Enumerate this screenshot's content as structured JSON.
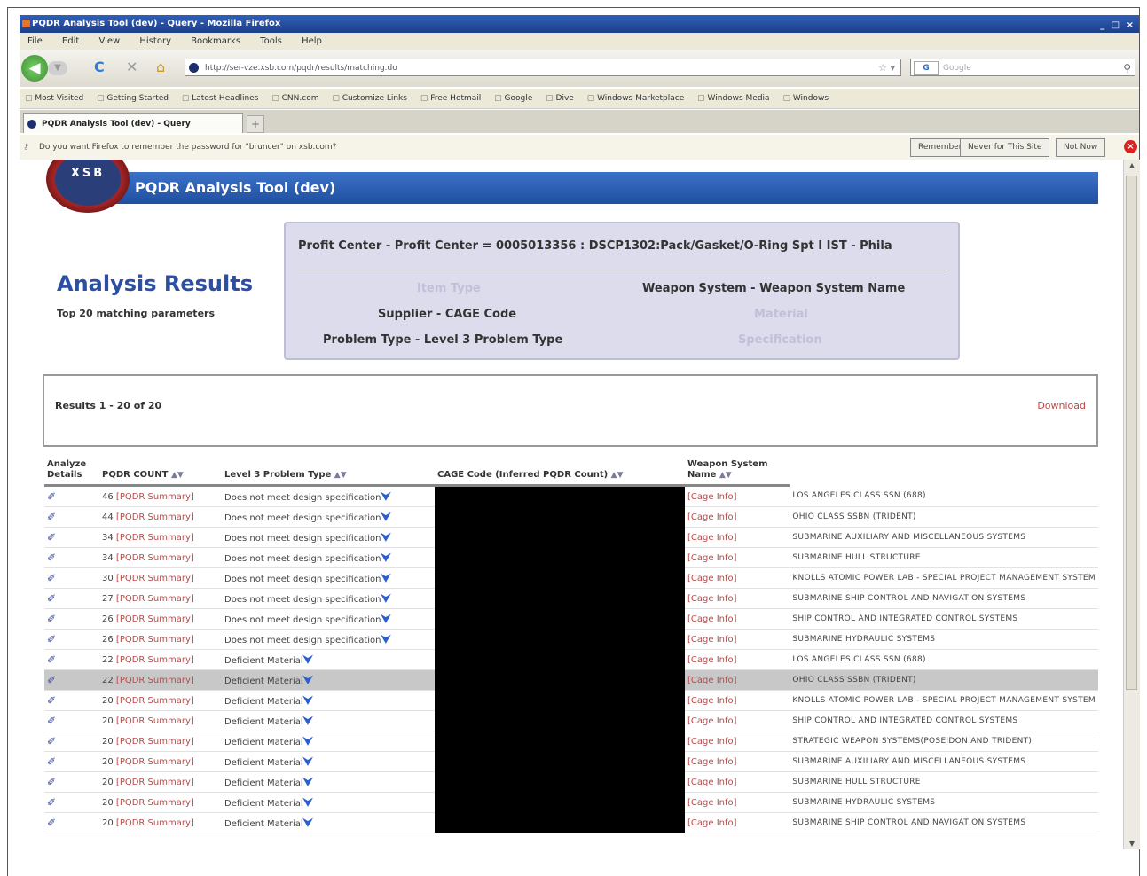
{
  "window": {
    "title": "PQDR Analysis Tool (dev) - Query - Mozilla Firefox",
    "controls": "_ □ ×"
  },
  "menu": [
    "File",
    "Edit",
    "View",
    "History",
    "Bookmarks",
    "Tools",
    "Help"
  ],
  "nav": {
    "back": "◀",
    "forward": "▼",
    "reload": "C",
    "stop": "✕",
    "home": "⌂",
    "url": "http://ser-vze.xsb.com/pqdr/results/matching.do",
    "star": "☆ ▾",
    "search_engine": "G",
    "search_placeholder": "Google",
    "search_btn": "⚲"
  },
  "bookmarks": [
    "Most Visited",
    "Getting Started",
    "Latest Headlines",
    "CNN.com",
    "Customize Links",
    "Free Hotmail",
    "Google",
    "Dive",
    "Windows Marketplace",
    "Windows Media",
    "Windows"
  ],
  "tab": {
    "title": "PQDR Analysis Tool (dev) - Query",
    "new": "+"
  },
  "notification": {
    "text": "Do you want Firefox to remember the password for \"bruncer\" on xsb.com?",
    "buttons": [
      "Remember",
      "Never for This Site",
      "Not Now"
    ],
    "close": "×"
  },
  "app": {
    "logo": "XSB",
    "banner": "PQDR Analysis Tool (dev)",
    "title": "Analysis Results",
    "subtitle": "Top 20 matching parameters"
  },
  "criteria": {
    "profit_center": "Profit Center - Profit Center = 0005013356 : DSCP1302:Pack/Gasket/O-Ring Spt I IST - Phila",
    "item_type": "Item Type",
    "weapon_system": "Weapon System - Weapon System Name",
    "supplier": "Supplier - CAGE Code",
    "material": "Material",
    "problem_type": "Problem Type - Level 3 Problem Type",
    "specification": "Specification"
  },
  "results": {
    "range": "Results 1 - 20 of 20",
    "download": "Download"
  },
  "table": {
    "headers": {
      "analyze": "Analyze Details",
      "count": "PQDR COUNT",
      "problem": "Level 3 Problem Type",
      "cage": "CAGE Code (Inferred PQDR Count)",
      "weapon": "Weapon System Name",
      "sort": "▲▼"
    },
    "analyze_icon": "✐",
    "chevron": "⮟",
    "summary_link": "[PQDR Summary]",
    "cage_link": "[Cage Info]",
    "rows": [
      {
        "count": "46",
        "problem": "Does not meet design specification",
        "weapon": "LOS ANGELES CLASS SSN (688)"
      },
      {
        "count": "44",
        "problem": "Does not meet design specification",
        "weapon": "OHIO CLASS SSBN (TRIDENT)"
      },
      {
        "count": "34",
        "problem": "Does not meet design specification",
        "weapon": "SUBMARINE AUXILIARY AND MISCELLANEOUS SYSTEMS"
      },
      {
        "count": "34",
        "problem": "Does not meet design specification",
        "weapon": "SUBMARINE HULL STRUCTURE"
      },
      {
        "count": "30",
        "problem": "Does not meet design specification",
        "weapon": "KNOLLS ATOMIC POWER LAB - SPECIAL PROJECT MANAGEMENT SYSTEM"
      },
      {
        "count": "27",
        "problem": "Does not meet design specification",
        "weapon": "SUBMARINE SHIP CONTROL AND NAVIGATION SYSTEMS"
      },
      {
        "count": "26",
        "problem": "Does not meet design specification",
        "weapon": "SHIP CONTROL AND INTEGRATED CONTROL SYSTEMS"
      },
      {
        "count": "26",
        "problem": "Does not meet design specification",
        "weapon": "SUBMARINE HYDRAULIC SYSTEMS"
      },
      {
        "count": "22",
        "problem": "Deficient Material",
        "weapon": "LOS ANGELES CLASS SSN (688)"
      },
      {
        "count": "22",
        "problem": "Deficient Material",
        "weapon": "OHIO CLASS SSBN (TRIDENT)"
      },
      {
        "count": "20",
        "problem": "Deficient Material",
        "weapon": "KNOLLS ATOMIC POWER LAB - SPECIAL PROJECT MANAGEMENT SYSTEM"
      },
      {
        "count": "20",
        "problem": "Deficient Material",
        "weapon": "SHIP CONTROL AND INTEGRATED CONTROL SYSTEMS"
      },
      {
        "count": "20",
        "problem": "Deficient Material",
        "weapon": "STRATEGIC WEAPON SYSTEMS(POSEIDON AND TRIDENT)"
      },
      {
        "count": "20",
        "problem": "Deficient Material",
        "weapon": "SUBMARINE AUXILIARY AND MISCELLANEOUS SYSTEMS"
      },
      {
        "count": "20",
        "problem": "Deficient Material",
        "weapon": "SUBMARINE HULL STRUCTURE"
      },
      {
        "count": "20",
        "problem": "Deficient Material",
        "weapon": "SUBMARINE HYDRAULIC SYSTEMS"
      },
      {
        "count": "20",
        "problem": "Deficient Material",
        "weapon": "SUBMARINE SHIP CONTROL AND NAVIGATION SYSTEMS"
      }
    ]
  },
  "scroll": {
    "up": "▲",
    "down": "▼"
  }
}
